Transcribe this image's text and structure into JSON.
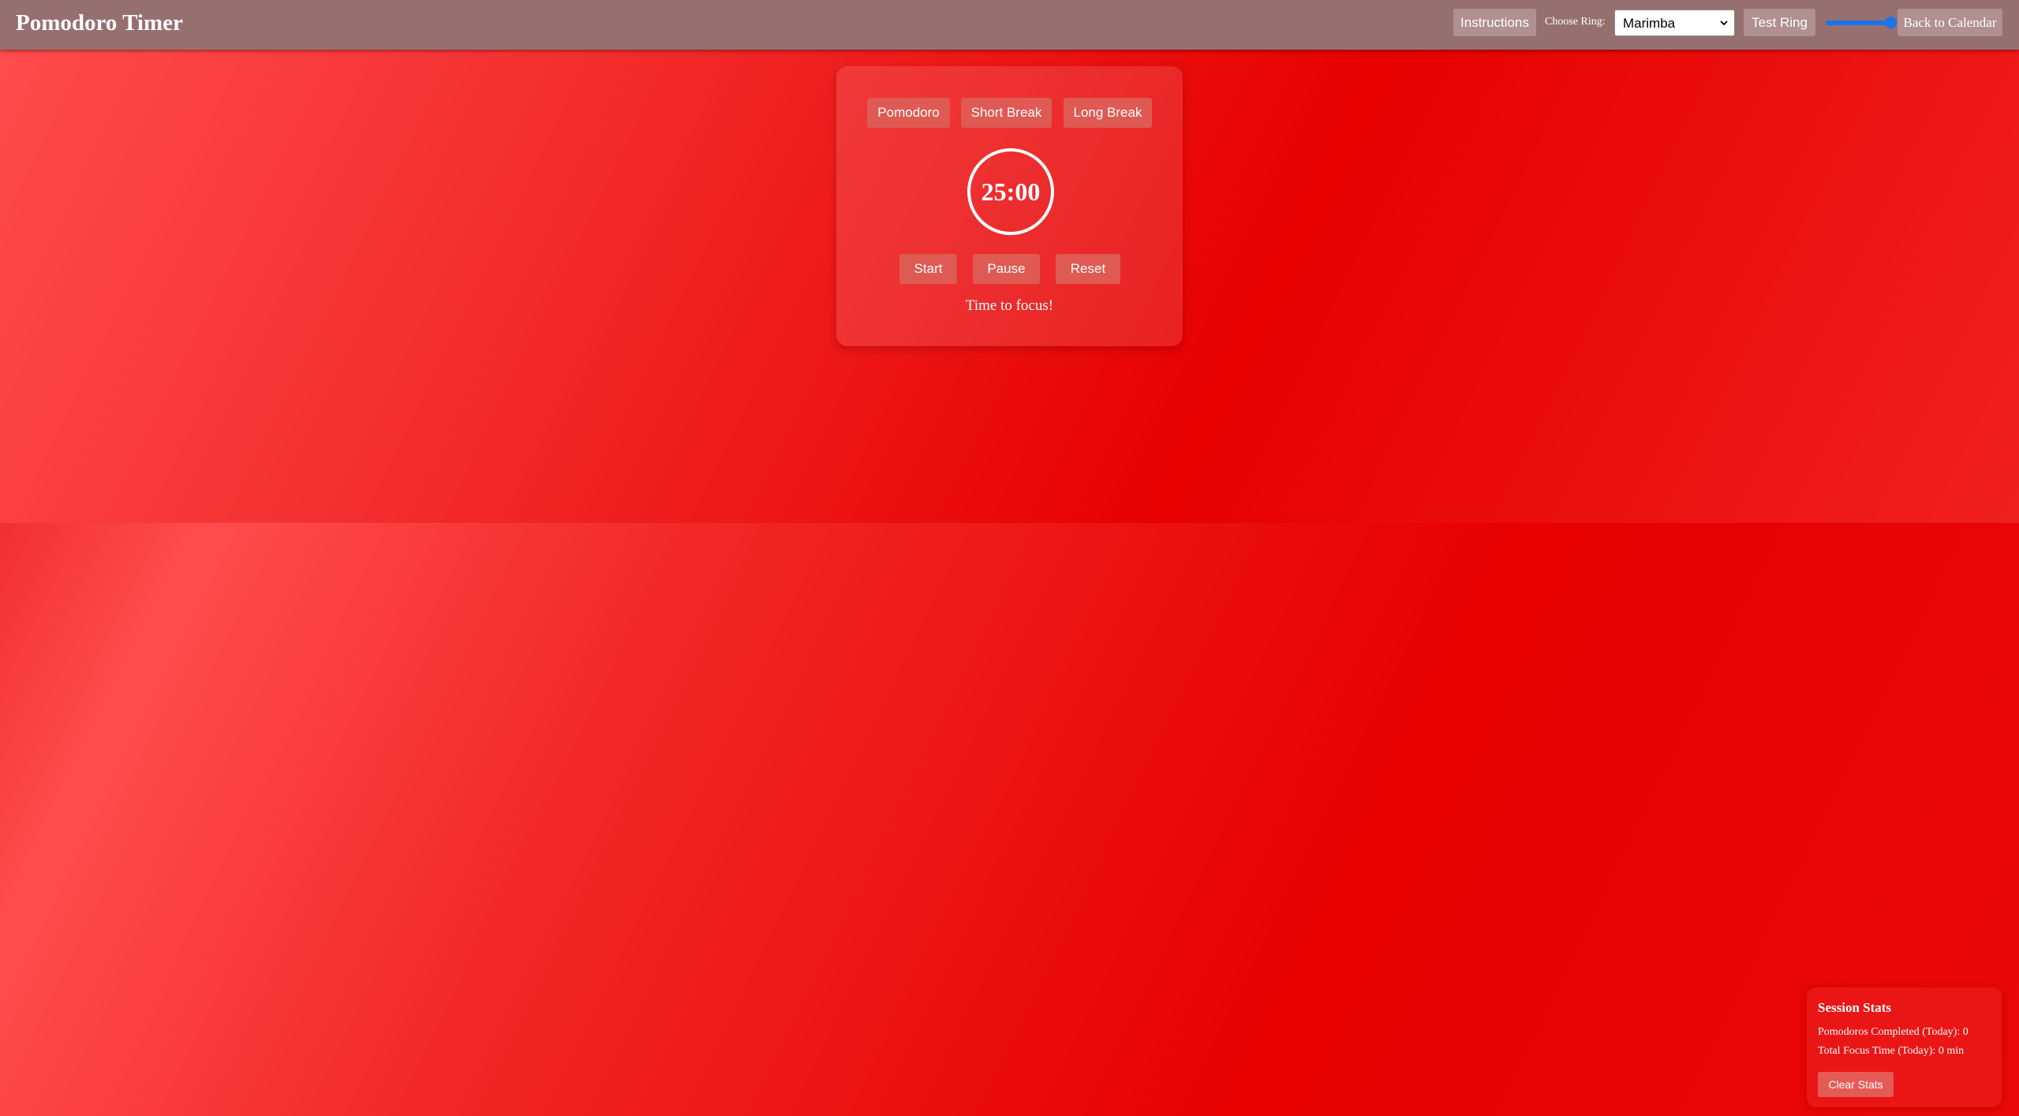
{
  "app": {
    "title": "Pomodoro Timer"
  },
  "header": {
    "instructions_label": "Instructions",
    "ring_label": "Choose Ring:",
    "ring_selected": "Marimba",
    "test_ring_label": "Test Ring",
    "volume_level": 1.0,
    "back_label": "Back to Calendar"
  },
  "timer": {
    "modes": [
      "Pomodoro",
      "Short Break",
      "Long Break"
    ],
    "display": "25:00",
    "controls": [
      "Start",
      "Pause",
      "Reset"
    ],
    "status": "Time to focus!"
  },
  "stats": {
    "title": "Session Stats",
    "pomodoros_completed": "Pomodoros Completed (Today): 0",
    "total_focus_time": "Total Focus Time (Today): 0 min",
    "clear_label": "Clear Stats"
  },
  "colors": {
    "background_accent": "#e60000",
    "header_bar": "#967070",
    "volume_slider": "#1a73e8"
  }
}
